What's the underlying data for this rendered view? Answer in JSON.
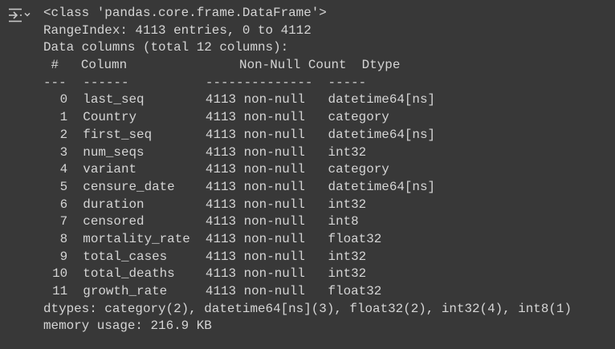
{
  "toolbar": {
    "output_icon": "clear-output-icon"
  },
  "output": {
    "class_line": "<class 'pandas.core.frame.DataFrame'>",
    "range_index": "RangeIndex: 4113 entries, 0 to 4112",
    "data_columns": "Data columns (total 12 columns):",
    "headers": {
      "index": "#",
      "column": "Column",
      "non_null": "Non-Null Count",
      "dtype": "Dtype"
    },
    "separators": {
      "index": "---",
      "column": "------",
      "non_null": "--------------",
      "dtype": "-----"
    },
    "rows": [
      {
        "idx": "0",
        "column": "last_seq",
        "non_null": "4113 non-null",
        "dtype": "datetime64[ns]"
      },
      {
        "idx": "1",
        "column": "Country",
        "non_null": "4113 non-null",
        "dtype": "category"
      },
      {
        "idx": "2",
        "column": "first_seq",
        "non_null": "4113 non-null",
        "dtype": "datetime64[ns]"
      },
      {
        "idx": "3",
        "column": "num_seqs",
        "non_null": "4113 non-null",
        "dtype": "int32"
      },
      {
        "idx": "4",
        "column": "variant",
        "non_null": "4113 non-null",
        "dtype": "category"
      },
      {
        "idx": "5",
        "column": "censure_date",
        "non_null": "4113 non-null",
        "dtype": "datetime64[ns]"
      },
      {
        "idx": "6",
        "column": "duration",
        "non_null": "4113 non-null",
        "dtype": "int32"
      },
      {
        "idx": "7",
        "column": "censored",
        "non_null": "4113 non-null",
        "dtype": "int8"
      },
      {
        "idx": "8",
        "column": "mortality_rate",
        "non_null": "4113 non-null",
        "dtype": "float32"
      },
      {
        "idx": "9",
        "column": "total_cases",
        "non_null": "4113 non-null",
        "dtype": "int32"
      },
      {
        "idx": "10",
        "column": "total_deaths",
        "non_null": "4113 non-null",
        "dtype": "int32"
      },
      {
        "idx": "11",
        "column": "growth_rate",
        "non_null": "4113 non-null",
        "dtype": "float32"
      }
    ],
    "dtypes_line": "dtypes: category(2), datetime64[ns](3), float32(2), int32(4), int8(1)",
    "memory_line": "memory usage: 216.9 KB"
  }
}
